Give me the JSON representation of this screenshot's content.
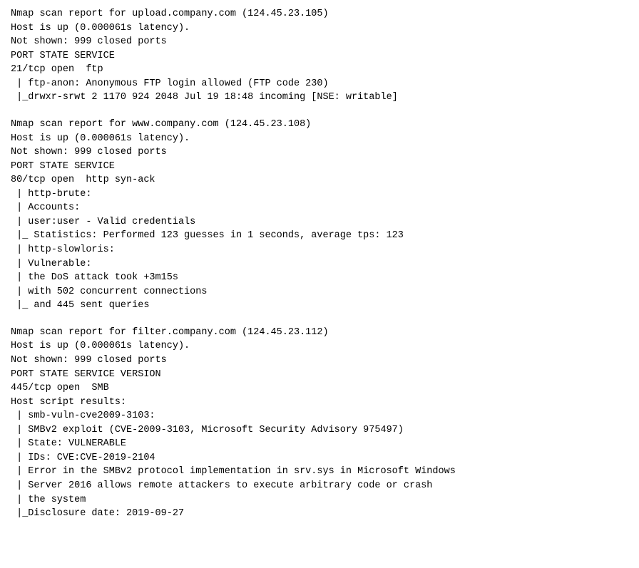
{
  "sections": [
    {
      "id": "section1",
      "lines": [
        "Nmap scan report for upload.company.com (124.45.23.105)",
        "Host is up (0.000061s latency).",
        "Not shown: 999 closed ports",
        "PORT STATE SERVICE",
        "21/tcp open  ftp",
        " | ftp-anon: Anonymous FTP login allowed (FTP code 230)",
        " |_drwxr-srwt 2 1170 924 2048 Jul 19 18:48 incoming [NSE: writable]"
      ]
    },
    {
      "id": "section2",
      "lines": [
        "Nmap scan report for www.company.com (124.45.23.108)",
        "Host is up (0.000061s latency).",
        "Not shown: 999 closed ports",
        "PORT STATE SERVICE",
        "80/tcp open  http syn-ack",
        " | http-brute:",
        " | Accounts:",
        " | user:user - Valid credentials",
        " |_ Statistics: Performed 123 guesses in 1 seconds, average tps: 123",
        " | http-slowloris:",
        " | Vulnerable:",
        " | the DoS attack took +3m15s",
        " | with 502 concurrent connections",
        " |_ and 445 sent queries"
      ]
    },
    {
      "id": "section3",
      "lines": [
        "Nmap scan report for filter.company.com (124.45.23.112)",
        "Host is up (0.000061s latency).",
        "Not shown: 999 closed ports",
        "PORT STATE SERVICE VERSION",
        "445/tcp open  SMB",
        "Host script results:",
        " | smb-vuln-cve2009-3103:",
        " | SMBv2 exploit (CVE-2009-3103, Microsoft Security Advisory 975497)",
        " | State: VULNERABLE",
        " | IDs: CVE:CVE-2019-2104",
        " | Error in the SMBv2 protocol implementation in srv.sys in Microsoft Windows",
        " | Server 2016 allows remote attackers to execute arbitrary code or crash",
        " | the system",
        " |_Disclosure date: 2019-09-27"
      ]
    }
  ]
}
